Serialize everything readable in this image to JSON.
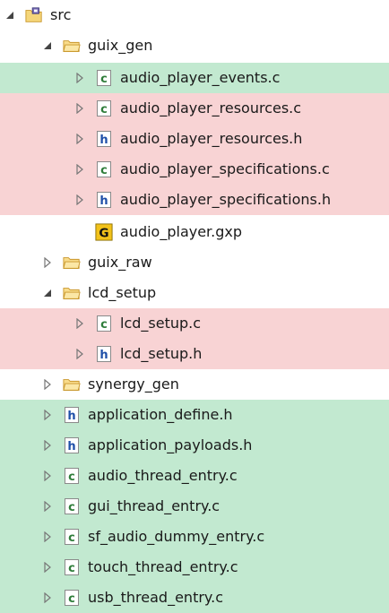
{
  "colors": {
    "added": "#c2e9d0",
    "modified": "#f8d3d4",
    "folder": "#e8b83c",
    "c_letter": "#2f7d3a",
    "h_letter": "#1f4fa8"
  },
  "tree": {
    "root": {
      "label": "src",
      "icon": "source-folder-icon",
      "twisty": "expanded"
    },
    "guix_gen": {
      "label": "guix_gen",
      "icon": "folder-icon",
      "twisty": "expanded"
    },
    "audio_player_events_c": {
      "label": "audio_player_events.c",
      "icon": "c-file-icon",
      "twisty": "collapsed"
    },
    "audio_player_resources_c": {
      "label": "audio_player_resources.c",
      "icon": "c-file-icon",
      "twisty": "collapsed"
    },
    "audio_player_resources_h": {
      "label": "audio_player_resources.h",
      "icon": "h-file-icon",
      "twisty": "collapsed"
    },
    "audio_player_specifications_c": {
      "label": "audio_player_specifications.c",
      "icon": "c-file-icon",
      "twisty": "collapsed"
    },
    "audio_player_specifications_h": {
      "label": "audio_player_specifications.h",
      "icon": "h-file-icon",
      "twisty": "collapsed"
    },
    "audio_player_gxp": {
      "label": "audio_player.gxp",
      "icon": "guix-project-icon",
      "icon_letter": "G",
      "twisty": "none"
    },
    "guix_raw": {
      "label": "guix_raw",
      "icon": "folder-icon",
      "twisty": "collapsed"
    },
    "lcd_setup": {
      "label": "lcd_setup",
      "icon": "folder-icon",
      "twisty": "expanded"
    },
    "lcd_setup_c": {
      "label": "lcd_setup.c",
      "icon": "c-file-icon",
      "twisty": "collapsed"
    },
    "lcd_setup_h": {
      "label": "lcd_setup.h",
      "icon": "h-file-icon",
      "twisty": "collapsed"
    },
    "synergy_gen": {
      "label": "synergy_gen",
      "icon": "folder-icon",
      "twisty": "collapsed"
    },
    "application_define_h": {
      "label": "application_define.h",
      "icon": "h-file-icon",
      "twisty": "collapsed"
    },
    "application_payloads_h": {
      "label": "application_payloads.h",
      "icon": "h-file-icon",
      "twisty": "collapsed"
    },
    "audio_thread_entry_c": {
      "label": "audio_thread_entry.c",
      "icon": "c-file-icon",
      "twisty": "collapsed"
    },
    "gui_thread_entry_c": {
      "label": "gui_thread_entry.c",
      "icon": "c-file-icon",
      "twisty": "collapsed"
    },
    "sf_audio_dummy_entry_c": {
      "label": "sf_audio_dummy_entry.c",
      "icon": "c-file-icon",
      "twisty": "collapsed"
    },
    "touch_thread_entry_c": {
      "label": "touch_thread_entry.c",
      "icon": "c-file-icon",
      "twisty": "collapsed"
    },
    "usb_thread_entry_c": {
      "label": "usb_thread_entry.c",
      "icon": "c-file-icon",
      "twisty": "collapsed"
    }
  },
  "icon_letters": {
    "c_file": "c",
    "h_file": "h"
  }
}
